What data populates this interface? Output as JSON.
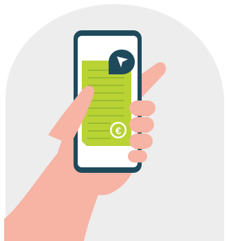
{
  "illustration": {
    "subject": "hand-holding-smartphone",
    "colors": {
      "background_blob": "#ECEDEC",
      "skin": "#F7B3A4",
      "skin_shadow": "#EF9F8C",
      "phone_frame": "#1E4A5C",
      "screen": "#FFFFFF",
      "document": "#B9D234",
      "document_lines": "#86AE2F",
      "euro_badge": "#FFFFFF",
      "pin": "#1E4A5C"
    },
    "icons": [
      "navigation-arrow-icon",
      "euro-icon"
    ]
  }
}
